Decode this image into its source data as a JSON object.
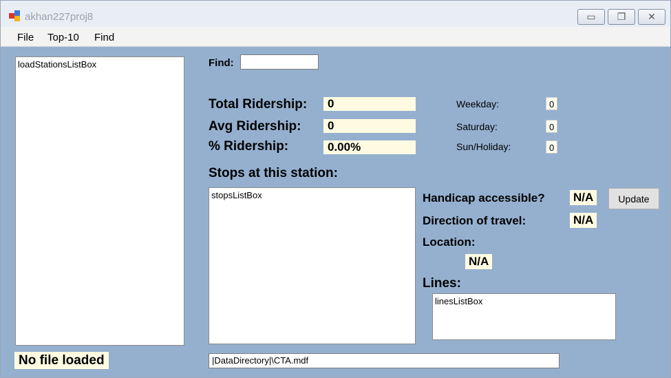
{
  "window": {
    "title": "akhan227proj8",
    "controls": {
      "minimize": "▭",
      "maximize": "❐",
      "close": "✕"
    }
  },
  "menu": [
    "File",
    "Top-10",
    "Find"
  ],
  "stations_listbox": {
    "label": "loadStationsListBox"
  },
  "status": {
    "text": "No file loaded"
  },
  "find": {
    "label": "Find:",
    "value": ""
  },
  "ridership": {
    "total_label": "Total Ridership:",
    "total_value": "0",
    "avg_label": "Avg Ridership:",
    "avg_value": "0",
    "pct_label": "% Ridership:",
    "pct_value": "0.00%"
  },
  "daytypes": {
    "weekday_label": "Weekday:",
    "weekday_value": "0",
    "saturday_label": "Saturday:",
    "saturday_value": "0",
    "sunholiday_label": "Sun/Holiday:",
    "sunholiday_value": "0"
  },
  "stops": {
    "heading": "Stops at this station:",
    "listbox_label": "stopsListBox"
  },
  "details": {
    "handicap_label": "Handicap accessible?",
    "handicap_value": "N/A",
    "update_button": "Update",
    "direction_label": "Direction of travel:",
    "direction_value": "N/A",
    "location_label": "Location:",
    "location_value": "N/A",
    "lines_label": "Lines:",
    "lines_listbox_label": "linesListBox"
  },
  "connection": {
    "value": "|DataDirectory|\\CTA.mdf"
  },
  "colors": {
    "form_background": "#95b0cf",
    "value_background": "#fefbe2",
    "titlebar": "#e9eef5"
  }
}
